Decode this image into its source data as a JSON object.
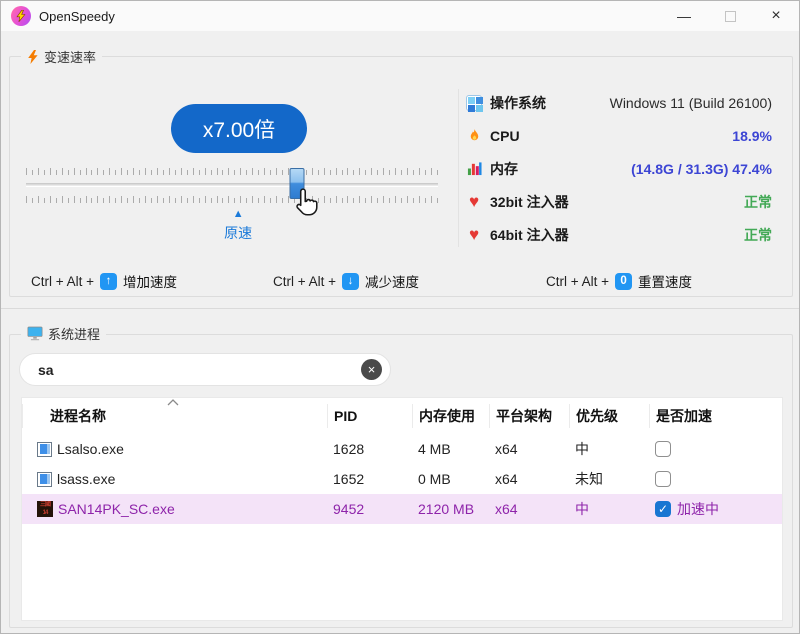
{
  "window": {
    "title": "OpenSpeedy"
  },
  "titlebar": {
    "minimize_icon": "—",
    "maximize_icon": "maximize",
    "close_icon": "×"
  },
  "speed_section": {
    "title": "变速速率",
    "speed_label": "x7.00倍",
    "origin_arrow": "▲",
    "origin_label": "原速",
    "slider_percent": 65.8,
    "origin_percent": 51.5
  },
  "system_info": {
    "rows": [
      {
        "icon": "os-icon",
        "label": "操作系统",
        "value": "Windows 11 (Build 26100)",
        "color_class": "val-dark"
      },
      {
        "icon": "flame-icon",
        "label": "CPU",
        "value": "18.9%",
        "color_class": "val-blue"
      },
      {
        "icon": "memory-icon",
        "label": "内存",
        "value": "(14.8G / 31.3G) 47.4%",
        "color_class": "val-blue"
      },
      {
        "icon": "heart-icon",
        "label": "32bit 注入器",
        "value": "正常",
        "color_class": "val-green"
      },
      {
        "icon": "heart-icon",
        "label": "64bit 注入器",
        "value": "正常",
        "color_class": "val-green"
      }
    ]
  },
  "hotkeys": [
    {
      "prefix": "Ctrl + Alt +",
      "key_glyph": "↑",
      "action": "增加速度"
    },
    {
      "prefix": "Ctrl + Alt +",
      "key_glyph": "↓",
      "action": "减少速度"
    },
    {
      "prefix": "Ctrl + Alt +",
      "key_glyph": "0",
      "action": "重置速度"
    }
  ],
  "process_section": {
    "title": "系统进程",
    "search": {
      "value": "sa",
      "clear_icon": "×"
    },
    "table": {
      "columns": [
        "进程名称",
        "PID",
        "内存使用",
        "平台架构",
        "优先级",
        "是否加速"
      ],
      "rows": [
        {
          "name": "Lsalso.exe",
          "pid": "1628",
          "memory": "4 MB",
          "arch": "x64",
          "priority": "中",
          "accelerated": false,
          "accel_label": ""
        },
        {
          "name": "lsass.exe",
          "pid": "1652",
          "memory": "0 MB",
          "arch": "x64",
          "priority": "未知",
          "accelerated": false,
          "accel_label": ""
        },
        {
          "name": "SAN14PK_SC.exe",
          "pid": "9452",
          "memory": "2120 MB",
          "arch": "x64",
          "priority": "中",
          "accelerated": true,
          "accel_label": "加速中"
        }
      ]
    }
  },
  "colors": {
    "accent_blue": "#1368c9",
    "origin_blue": "#1b7ad9",
    "value_blue": "#3c45d4",
    "ok_green": "#43a956",
    "heart_red": "#e53935",
    "key_blue": "#2196f3",
    "highlight_bg": "#f4e3f8",
    "highlight_text": "#8e24aa",
    "check_blue": "#1976d2"
  }
}
